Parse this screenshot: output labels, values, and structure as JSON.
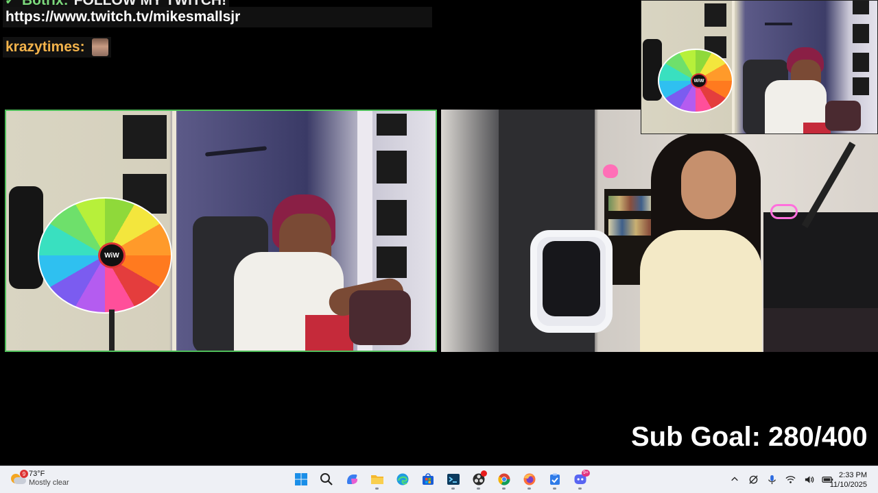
{
  "chat": {
    "partial_line_name": "Botrix:",
    "partial_line_text": "FOLLOW MY TWITCH!",
    "url_line": "https://www.twitch.tv/mikesmallsjr",
    "user_line_name": "krazytimes:"
  },
  "wheel_hub_label": "WiW",
  "sub_goal": {
    "label": "Sub Goal: 280/400",
    "current": 280,
    "target": 400
  },
  "taskbar": {
    "weather": {
      "temp": "73°F",
      "condition": "Mostly clear",
      "badge": "9"
    },
    "apps": [
      {
        "name": "windows-start",
        "icon": "windows-logo-icon"
      },
      {
        "name": "search",
        "icon": "search-icon"
      },
      {
        "name": "copilot",
        "icon": "copilot-icon"
      },
      {
        "name": "file-explorer",
        "icon": "folder-icon"
      },
      {
        "name": "edge",
        "icon": "edge-icon"
      },
      {
        "name": "microsoft-store",
        "icon": "store-icon"
      },
      {
        "name": "terminal",
        "icon": "terminal-icon"
      },
      {
        "name": "obs",
        "icon": "obs-icon"
      },
      {
        "name": "chrome",
        "icon": "chrome-icon"
      },
      {
        "name": "firefox",
        "icon": "firefox-icon"
      },
      {
        "name": "task-app",
        "icon": "clipboard-check-icon"
      },
      {
        "name": "discord",
        "icon": "discord-icon",
        "badge": "9+"
      }
    ],
    "tray": [
      "chevron-up-icon",
      "network-off-icon",
      "microphone-icon",
      "wifi-icon",
      "volume-icon",
      "battery-icon"
    ],
    "time": "2:33 PM",
    "date": "11/10/2025"
  },
  "colors": {
    "cam_border": "#4fbf5a",
    "username": "#f3b34b",
    "taskbar_bg": "#eef0f5"
  }
}
